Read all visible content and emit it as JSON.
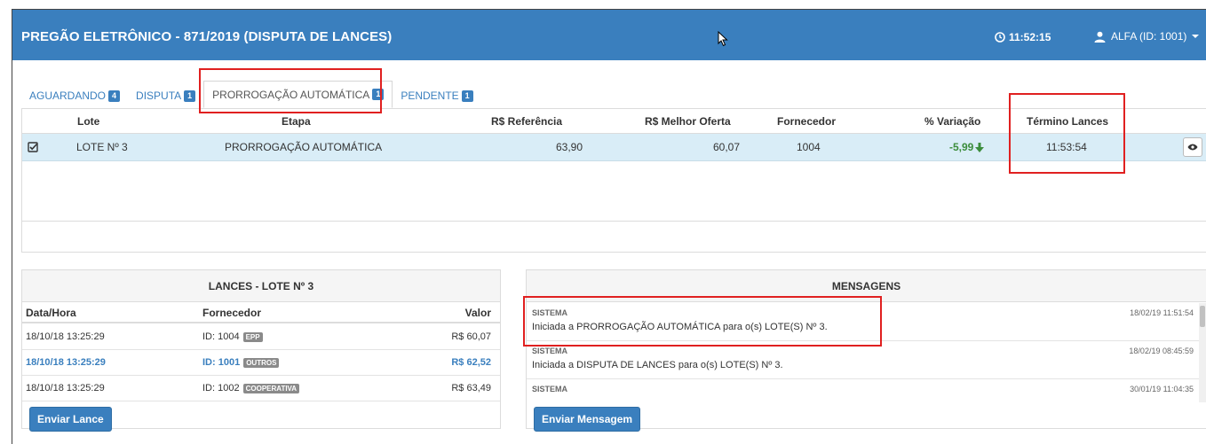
{
  "header": {
    "title": "PREGÃO ELETRÔNICO - 871/2019 (DISPUTA DE LANCES)",
    "clock": "11:52:15",
    "user": "ALFA (ID: 1001)"
  },
  "tabs": [
    {
      "label": "AGUARDANDO",
      "count": "4"
    },
    {
      "label": "DISPUTA",
      "count": "1"
    },
    {
      "label": "PRORROGAÇÃO AUTOMÁTICA",
      "count": "1"
    },
    {
      "label": "PENDENTE",
      "count": "1"
    }
  ],
  "lots_table": {
    "columns": {
      "lote": "Lote",
      "etapa": "Etapa",
      "referencia": "R$ Referência",
      "melhor_oferta": "R$ Melhor Oferta",
      "fornecedor": "Fornecedor",
      "variacao": "% Variação",
      "termino": "Término Lances"
    },
    "row": {
      "lote": "LOTE Nº 3",
      "etapa": "PRORROGAÇÃO AUTOMÁTICA",
      "referencia": "63,90",
      "melhor_oferta": "60,07",
      "fornecedor": "1004",
      "variacao": "-5,99",
      "termino": "11:53:54"
    }
  },
  "bids": {
    "title": "LANCES - LOTE Nº 3",
    "columns": {
      "datetime": "Data/Hora",
      "supplier": "Fornecedor",
      "value": "Valor"
    },
    "rows": [
      {
        "datetime": "18/10/18 13:25:29",
        "supplier": "ID: 1004",
        "tag": "EPP",
        "value": "R$ 60,07"
      },
      {
        "datetime": "18/10/18 13:25:29",
        "supplier": "ID: 1001",
        "tag": "OUTROS",
        "value": "R$ 62,52"
      },
      {
        "datetime": "18/10/18 13:25:29",
        "supplier": "ID: 1002",
        "tag": "COOPERATIVA",
        "value": "R$ 63,49"
      }
    ],
    "button": "Enviar Lance"
  },
  "messages": {
    "title": "MENSAGENS",
    "items": [
      {
        "sender": "SISTEMA",
        "time": "18/02/19 11:51:54",
        "text": "Iniciada a PRORROGAÇÃO AUTOMÁTICA para o(s) LOTE(S) Nº 3."
      },
      {
        "sender": "SISTEMA",
        "time": "18/02/19 08:45:59",
        "text": "Iniciada a DISPUTA DE LANCES para o(s) LOTE(S) Nº 3."
      },
      {
        "sender": "SISTEMA",
        "time": "30/01/19 11:04:35",
        "text": ""
      }
    ],
    "button": "Enviar Mensagem"
  },
  "colors": {
    "primary": "#3a7fbe",
    "row_highlight": "#d9edf7",
    "negative": "#3c8d3c",
    "annotation": "#e02020"
  }
}
